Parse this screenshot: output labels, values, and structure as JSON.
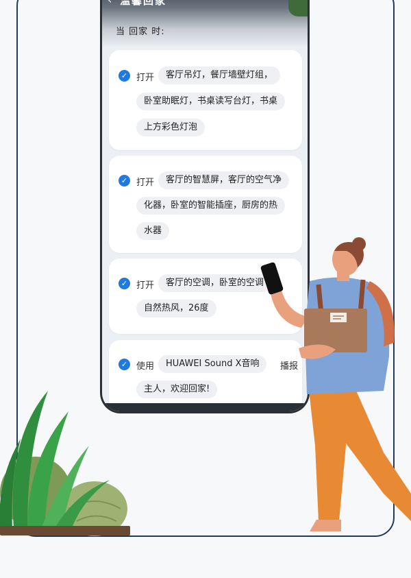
{
  "header": {
    "title": "温馨回家",
    "section_label": "当 回家 时:"
  },
  "cards": [
    {
      "verb": "打开",
      "chips": [
        "客厅吊灯，餐厅墙壁灯组，",
        "卧室助眠灯，书桌读写台灯，书桌",
        "上方彩色灯泡"
      ],
      "trail": ""
    },
    {
      "verb": "打开",
      "chips": [
        "客厅的智慧屏，客厅的空气净",
        "化器，卧室的智能插座，厨房的热",
        "水器"
      ],
      "trail": ""
    },
    {
      "verb": "打开",
      "chips": [
        "客厅的空调，卧室的空调",
        "自然热风，26度"
      ],
      "trail": ""
    },
    {
      "verb": "使用",
      "chips": [
        "HUAWEI Sound X音响",
        "主人，欢迎回家!"
      ],
      "trail": "播报"
    }
  ],
  "colors": {
    "accent": "#1f7ae0",
    "frame": "#1f3b5c",
    "shirt": "#7fa3d6",
    "pants": "#e88a34",
    "box": "#a8795a"
  }
}
